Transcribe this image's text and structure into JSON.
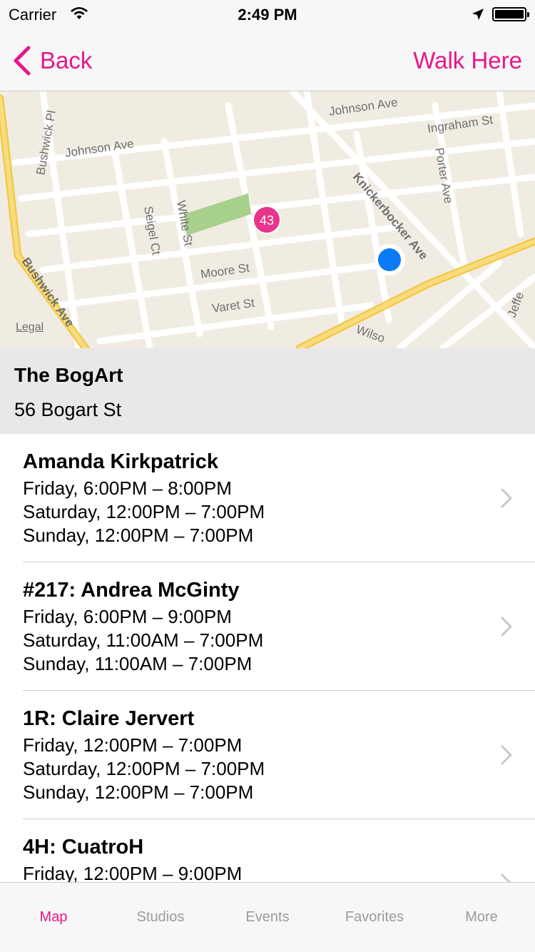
{
  "status_bar": {
    "carrier": "Carrier",
    "time": "2:49 PM"
  },
  "nav": {
    "back_label": "Back",
    "action_label": "Walk Here",
    "accent": "#e8168a"
  },
  "map": {
    "legal": "Legal",
    "pin_number": "43",
    "streets": [
      "Johnson Ave",
      "Johnson Ave",
      "Ingraham St",
      "Bushwick Pl",
      "Porter Ave",
      "Knickerbocker Ave",
      "Seigel Ct",
      "White St",
      "Moore St",
      "Varet St",
      "Bushwick Ave",
      "Wilso",
      "Jeffe"
    ]
  },
  "venue": {
    "name": "The BogArt",
    "address": "56 Bogart St"
  },
  "studios": [
    {
      "title": "Amanda Kirkpatrick",
      "hours": [
        "Friday, 6:00PM – 8:00PM",
        "Saturday, 12:00PM – 7:00PM",
        "Sunday, 12:00PM – 7:00PM"
      ]
    },
    {
      "title": "#217: Andrea McGinty",
      "hours": [
        "Friday, 6:00PM – 9:00PM",
        "Saturday, 11:00AM – 7:00PM",
        "Sunday, 11:00AM – 7:00PM"
      ]
    },
    {
      "title": "1R: Claire Jervert",
      "hours": [
        "Friday, 12:00PM – 7:00PM",
        "Saturday, 12:00PM – 7:00PM",
        "Sunday, 12:00PM – 7:00PM"
      ]
    },
    {
      "title": "4H: CuatroH",
      "hours": [
        "Friday, 12:00PM – 9:00PM"
      ]
    }
  ],
  "tabs": [
    {
      "label": "Map",
      "active": true
    },
    {
      "label": "Studios",
      "active": false
    },
    {
      "label": "Events",
      "active": false
    },
    {
      "label": "Favorites",
      "active": false
    },
    {
      "label": "More",
      "active": false
    }
  ]
}
